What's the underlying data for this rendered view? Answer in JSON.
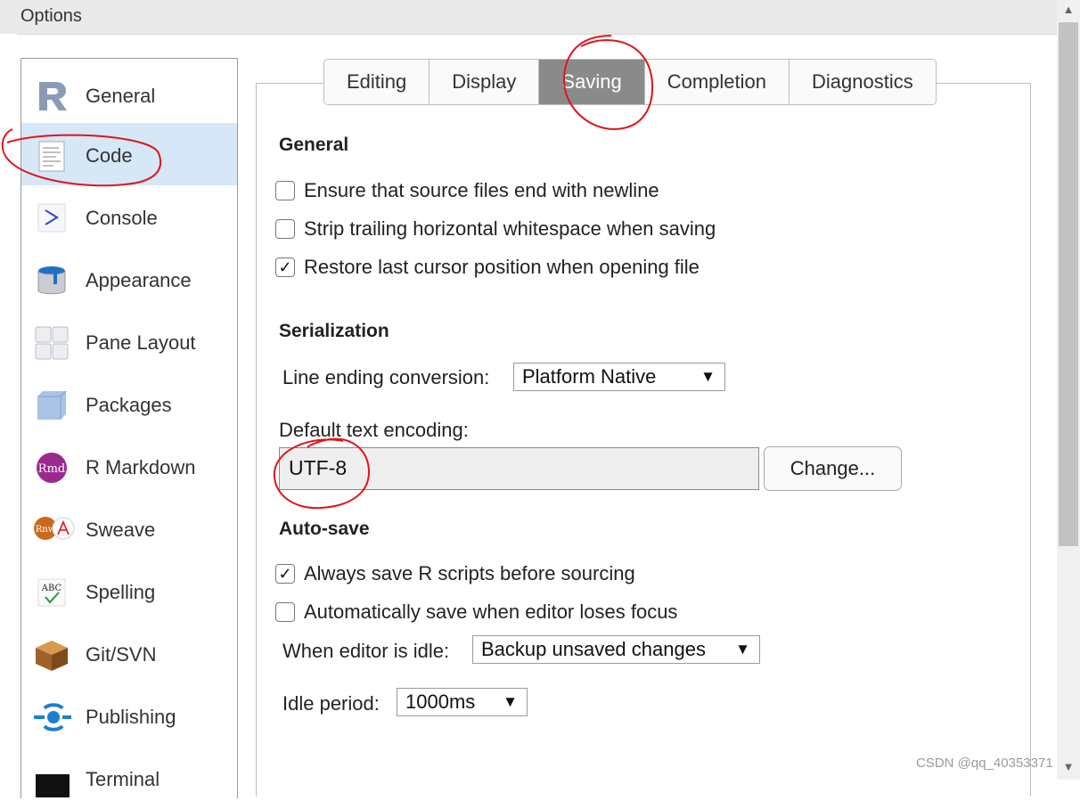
{
  "window": {
    "title": "Options"
  },
  "sidebar": {
    "items": [
      {
        "label": "General",
        "icon": "r-logo-icon"
      },
      {
        "label": "Code",
        "icon": "code-file-icon",
        "selected": true
      },
      {
        "label": "Console",
        "icon": "console-prompt-icon"
      },
      {
        "label": "Appearance",
        "icon": "paint-bucket-icon"
      },
      {
        "label": "Pane Layout",
        "icon": "pane-layout-icon"
      },
      {
        "label": "Packages",
        "icon": "package-box-icon"
      },
      {
        "label": "R Markdown",
        "icon": "rmd-icon",
        "icon_text": "Rmd"
      },
      {
        "label": "Sweave",
        "icon": "sweave-icon",
        "icon_text": "Rnw"
      },
      {
        "label": "Spelling",
        "icon": "spellcheck-icon",
        "icon_text": "ABC"
      },
      {
        "label": "Git/SVN",
        "icon": "git-box-icon"
      },
      {
        "label": "Publishing",
        "icon": "publishing-icon"
      },
      {
        "label": "Terminal",
        "icon": "terminal-icon"
      }
    ]
  },
  "tabs": [
    {
      "label": "Editing"
    },
    {
      "label": "Display"
    },
    {
      "label": "Saving",
      "selected": true
    },
    {
      "label": "Completion"
    },
    {
      "label": "Diagnostics"
    }
  ],
  "general": {
    "heading": "General",
    "options": [
      {
        "label": "Ensure that source files end with newline",
        "checked": false,
        "mark": ""
      },
      {
        "label": "Strip trailing horizontal whitespace when saving",
        "checked": false,
        "mark": ""
      },
      {
        "label": "Restore last cursor position when opening file",
        "checked": true,
        "mark": "✓"
      }
    ]
  },
  "serialization": {
    "heading": "Serialization",
    "line_ending_label": "Line ending conversion:",
    "line_ending_value": "Platform Native",
    "encoding_label": "Default text encoding:",
    "encoding_value": "UTF-8",
    "change_button": "Change..."
  },
  "autosave": {
    "heading": "Auto-save",
    "options": [
      {
        "label": "Always save R scripts before sourcing",
        "checked": true,
        "mark": "✓"
      },
      {
        "label": "Automatically save when editor loses focus",
        "checked": false,
        "mark": ""
      }
    ],
    "idle_label": "When editor is idle:",
    "idle_value": "Backup unsaved changes",
    "period_label": "Idle period:",
    "period_value": "1000ms"
  },
  "dropdown_arrow": "▼",
  "scroll": {
    "up": "▲",
    "down": "▼"
  },
  "watermark": "CSDN @qq_40353371",
  "colors": {
    "selected_sidebar": "#d6e7f7",
    "selected_tab": "#8a8a8a",
    "annotation": "#e0151b"
  }
}
